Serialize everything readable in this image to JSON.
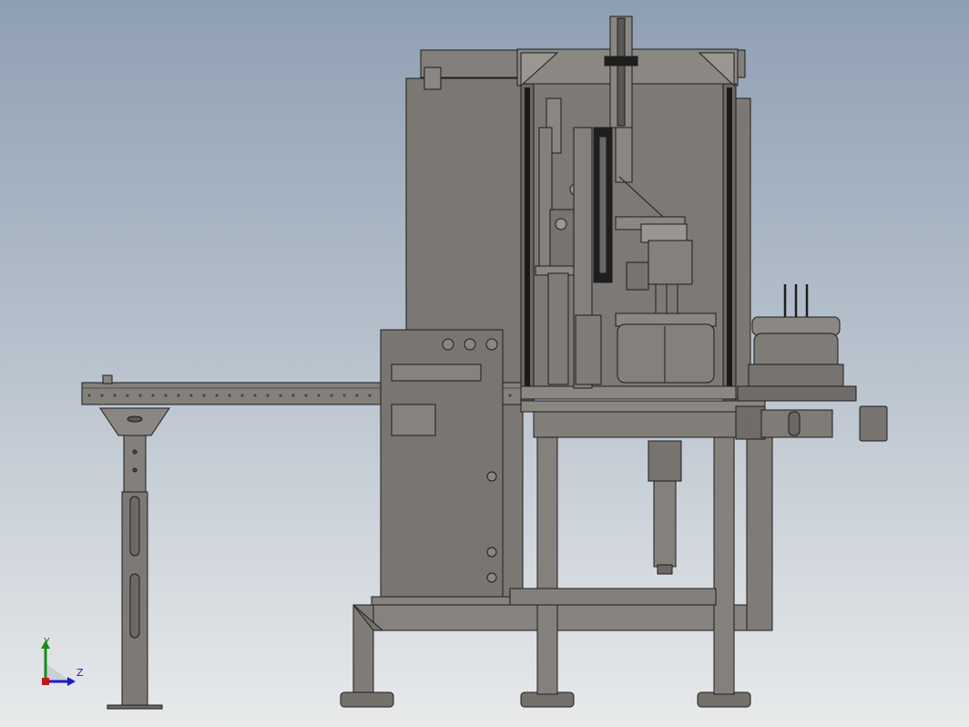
{
  "viewport": {
    "background_top": "#8f9fb3",
    "background_bottom": "#e8eaeb",
    "model_color": "#7f7b77",
    "edge_color": "#1e1e1e"
  },
  "triad": {
    "y_label": "Y",
    "z_label": "Z",
    "y_color": "#1a8a1a",
    "z_color": "#1a1ad0",
    "x_color": "#c01818"
  }
}
